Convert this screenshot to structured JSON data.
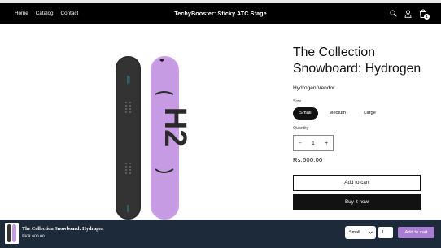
{
  "header": {
    "nav": [
      "Home",
      "Catalog",
      "Contact"
    ],
    "brand": "TechyBooster: Sticky ATC Stage",
    "cart_count": "1",
    "icons": [
      "search-icon",
      "account-icon",
      "cart-icon"
    ]
  },
  "product": {
    "title": "The Collection Snowboard: Hydrogen",
    "vendor": "Hydrogen Vendor",
    "size_label": "Size",
    "sizes": [
      "Small",
      "Medium",
      "Large"
    ],
    "selected_size": "Small",
    "quantity_label": "Quantity",
    "quantity": "1",
    "minus": "−",
    "plus": "+",
    "price": "Rs.600.00",
    "add_to_cart": "Add to cart",
    "buy_now": "Buy it now"
  },
  "sticky": {
    "title": "The Collection Snowboard: Hydrogen",
    "price": "PKR 600.00",
    "size": "Small",
    "quantity": "1",
    "add_label": "Add to cart",
    "button_color": "#a77ed1",
    "bar_color": "#1d2a3a"
  }
}
